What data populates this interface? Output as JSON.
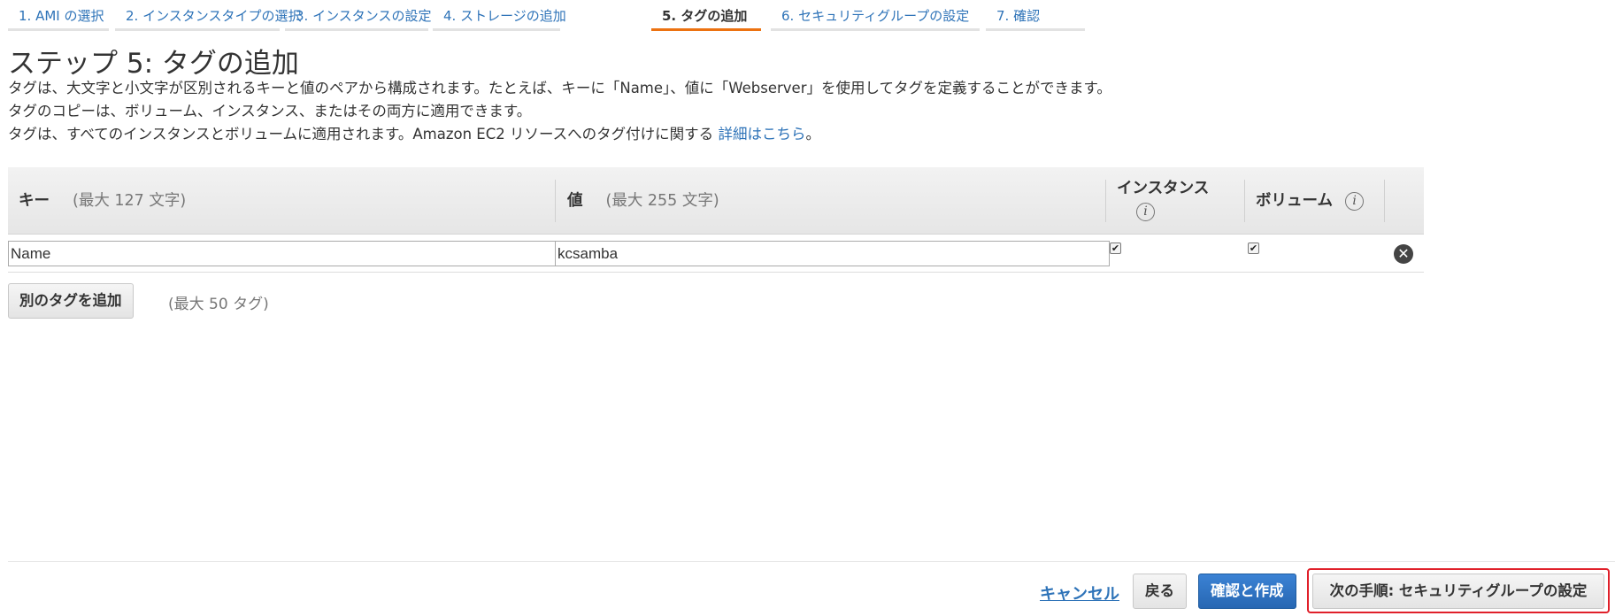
{
  "wizard": {
    "steps": [
      "1. AMI の選択",
      "2. インスタンスタイプの選択",
      "3. インスタンスの設定",
      "4. ストレージの追加",
      "5. タグの追加",
      "6. セキュリティグループの設定",
      "7. 確認"
    ],
    "active_step": 4
  },
  "page": {
    "title": "ステップ 5: タグの追加",
    "desc_line1": "タグは、大文字と小文字が区別されるキーと値のペアから構成されます。たとえば、キーに「Name」、値に「Webserver」を使用してタグを定義することができます。",
    "desc_line2": "タグのコピーは、ボリューム、インスタンス、またはその両方に適用できます。",
    "desc_line3": "タグは、すべてのインスタンスとボリュームに適用されます。Amazon EC2 リソースへのタグ付けに関する",
    "desc_link": "詳細はこちら",
    "desc_end": "。"
  },
  "table": {
    "headers": {
      "key": "キー",
      "key_hint": "(最大 127 文字)",
      "value": "値",
      "value_hint": "(最大 255 文字)",
      "instance": "インスタンス",
      "volume": "ボリューム"
    },
    "rows": [
      {
        "key": "Name",
        "value": "kcsamba",
        "instance": true,
        "volume": true
      }
    ]
  },
  "actions": {
    "add_tag": "別のタグを追加",
    "max_tags": "(最大 50 タグ)"
  },
  "footer": {
    "cancel": "キャンセル",
    "back": "戻る",
    "review_launch": "確認と作成",
    "next": "次の手順: セキュリティグループの設定"
  },
  "colors": {
    "link": "#2e73b8",
    "active_tab_underline": "#ec7211",
    "primary_button": "#2767b3",
    "highlight_border": "#e0202a"
  },
  "icons": {
    "info": "info-icon",
    "remove": "remove-tag-icon",
    "checked": "checkbox-checked-icon"
  }
}
